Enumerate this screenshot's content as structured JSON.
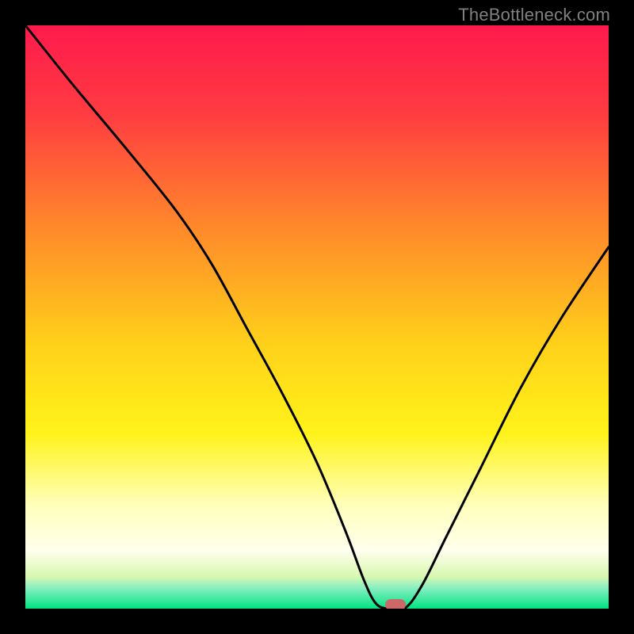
{
  "watermark": "TheBottleneck.com",
  "colors": {
    "frame": "#000000",
    "marker": "#cc6868",
    "curve": "#000000",
    "gradient_stops": [
      {
        "offset": 0.0,
        "color": "#ff1a4d"
      },
      {
        "offset": 0.15,
        "color": "#ff3b41"
      },
      {
        "offset": 0.35,
        "color": "#ff8a2a"
      },
      {
        "offset": 0.55,
        "color": "#ffd21a"
      },
      {
        "offset": 0.7,
        "color": "#fff31a"
      },
      {
        "offset": 0.82,
        "color": "#ffffb8"
      },
      {
        "offset": 0.9,
        "color": "#ffffee"
      },
      {
        "offset": 0.945,
        "color": "#d8f8b0"
      },
      {
        "offset": 0.965,
        "color": "#87eec1"
      },
      {
        "offset": 1.0,
        "color": "#00e381"
      }
    ]
  },
  "chart_data": {
    "type": "line",
    "title": "",
    "xlabel": "",
    "ylabel": "",
    "xlim": [
      0,
      100
    ],
    "ylim": [
      0,
      100
    ],
    "legend": false,
    "grid": false,
    "series": [
      {
        "name": "bottleneck-curve",
        "x": [
          0,
          8,
          18,
          26,
          32,
          38,
          44,
          50,
          55,
          58,
          60,
          62,
          65,
          68,
          72,
          78,
          85,
          92,
          100
        ],
        "values": [
          100,
          90,
          78,
          68,
          59,
          48,
          37,
          25,
          13,
          5,
          1,
          0,
          0,
          4,
          12,
          24,
          38,
          50,
          62
        ]
      }
    ],
    "marker": {
      "x": 63.5,
      "y": 0
    },
    "notes": "x is normalized horizontal position (0=left,100=right of plot area); values are bottleneck percentage (0=bottom/green optimal, 100=top/red). Minimum bottleneck around x≈62–65."
  }
}
